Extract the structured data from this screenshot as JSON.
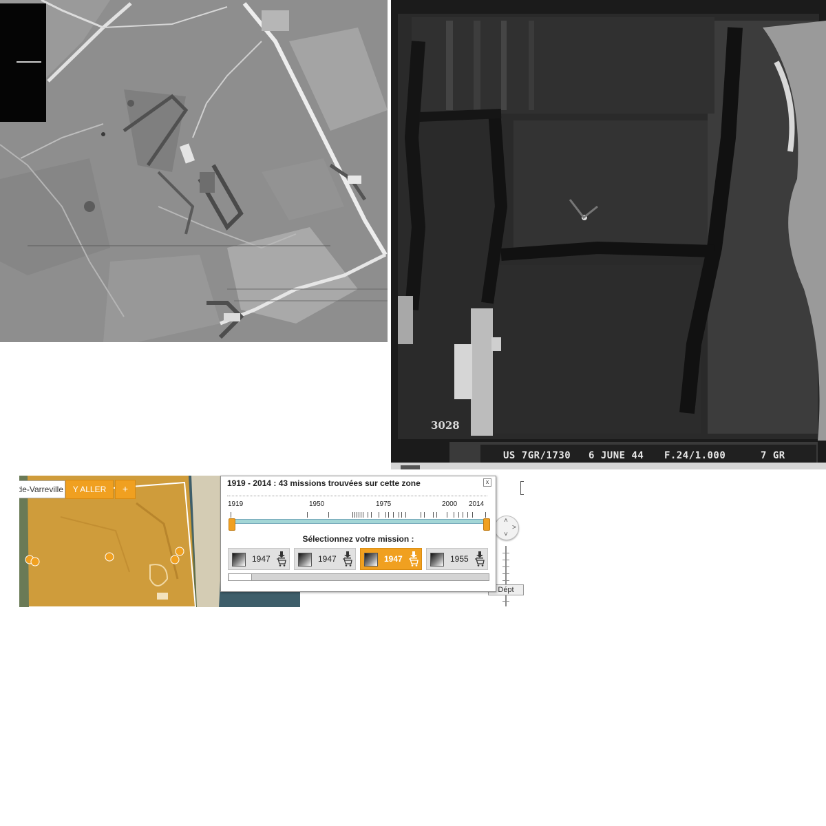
{
  "photos": {
    "left": {
      "icon": "aerial-photo-left"
    },
    "right": {
      "icon": "aerial-photo-right",
      "frame_number": "3028",
      "caption": {
        "sortie": "US 7GR/1730",
        "date": "6 JUNE 44",
        "lens": "F.24/1.000",
        "group": "7 GR"
      }
    }
  },
  "viewer": {
    "place_input": "de-Varreville",
    "go_button": "Y ALLER",
    "plus_button": "+",
    "zoom_tag": "Dépt",
    "accent": "#f0a020"
  },
  "popup": {
    "title": "1919 - 2014 : 43 missions trouvées sur cette zone",
    "close_label": "x",
    "timeline": {
      "labels": [
        "1919",
        "1950",
        "1975",
        "2000",
        "2014"
      ],
      "range": [
        1919,
        2014
      ]
    },
    "select_prompt": "Sélectionnez votre mission :",
    "missions": [
      {
        "year": "1947",
        "selected": false
      },
      {
        "year": "1947",
        "selected": false
      },
      {
        "year": "1947",
        "selected": true
      },
      {
        "year": "1955",
        "selected": false
      }
    ],
    "scroll_position": 0.08
  }
}
